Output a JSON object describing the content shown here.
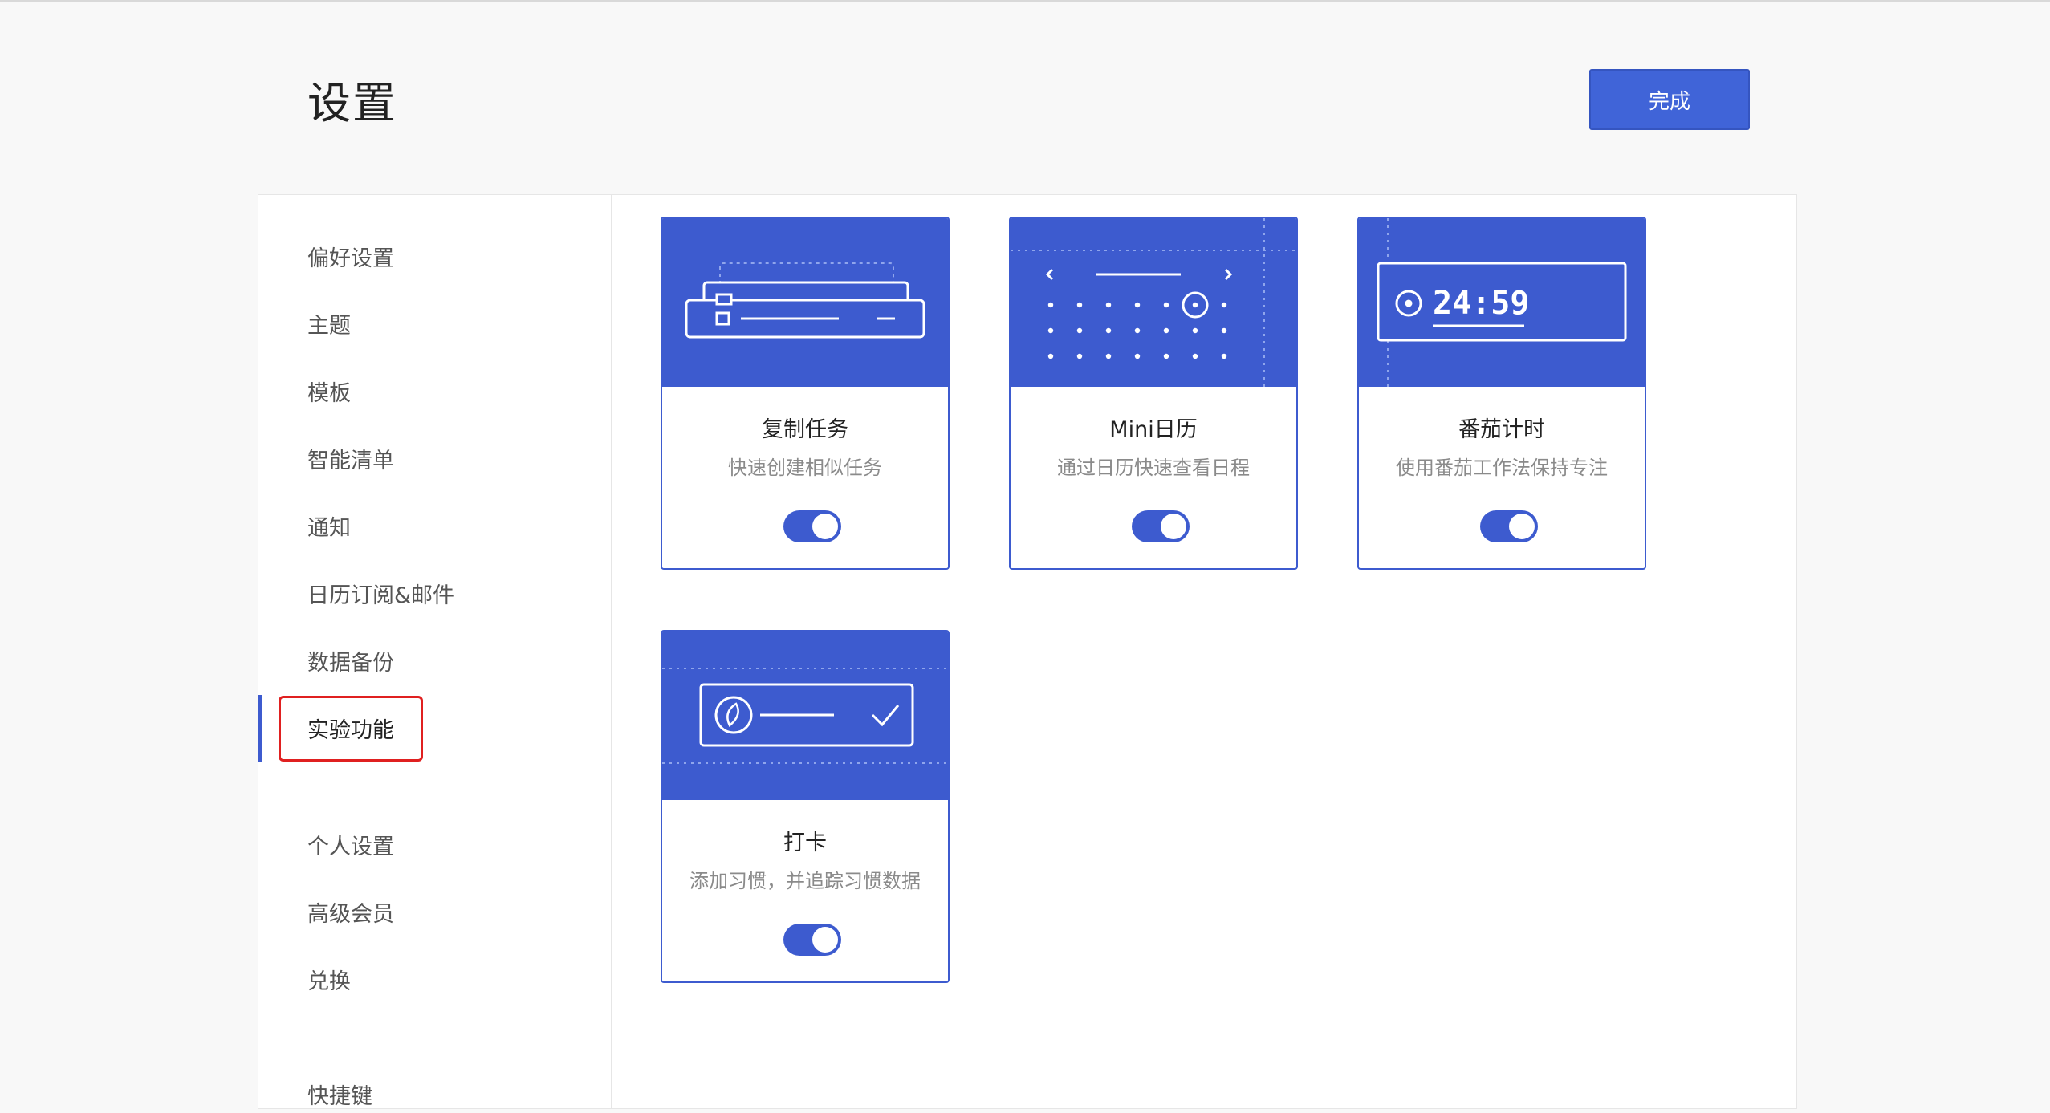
{
  "page": {
    "title": "设置",
    "done_label": "完成"
  },
  "sidebar": {
    "items": [
      {
        "label": "偏好设置"
      },
      {
        "label": "主题"
      },
      {
        "label": "模板"
      },
      {
        "label": "智能清单"
      },
      {
        "label": "通知"
      },
      {
        "label": "日历订阅&邮件"
      },
      {
        "label": "数据备份"
      },
      {
        "label": "实验功能",
        "active": true
      },
      {
        "label": "个人设置"
      },
      {
        "label": "高级会员"
      },
      {
        "label": "兑换"
      },
      {
        "label": "快捷键"
      }
    ]
  },
  "features": [
    {
      "title": "复制任务",
      "desc": "快速创建相似任务",
      "enabled": true,
      "icon": "duplicate-task-icon"
    },
    {
      "title": "Mini日历",
      "desc": "通过日历快速查看日程",
      "enabled": true,
      "icon": "mini-calendar-icon"
    },
    {
      "title": "番茄计时",
      "desc": "使用番茄工作法保持专注",
      "enabled": true,
      "icon": "pomodoro-timer-icon",
      "timer_text": "24:59"
    },
    {
      "title": "打卡",
      "desc": "添加习惯，并追踪习惯数据",
      "enabled": true,
      "icon": "habit-checkin-icon"
    }
  ],
  "colors": {
    "accent": "#3d5bcf",
    "button": "#4064d8",
    "highlight": "#e02020",
    "background": "#f8f8f8"
  }
}
